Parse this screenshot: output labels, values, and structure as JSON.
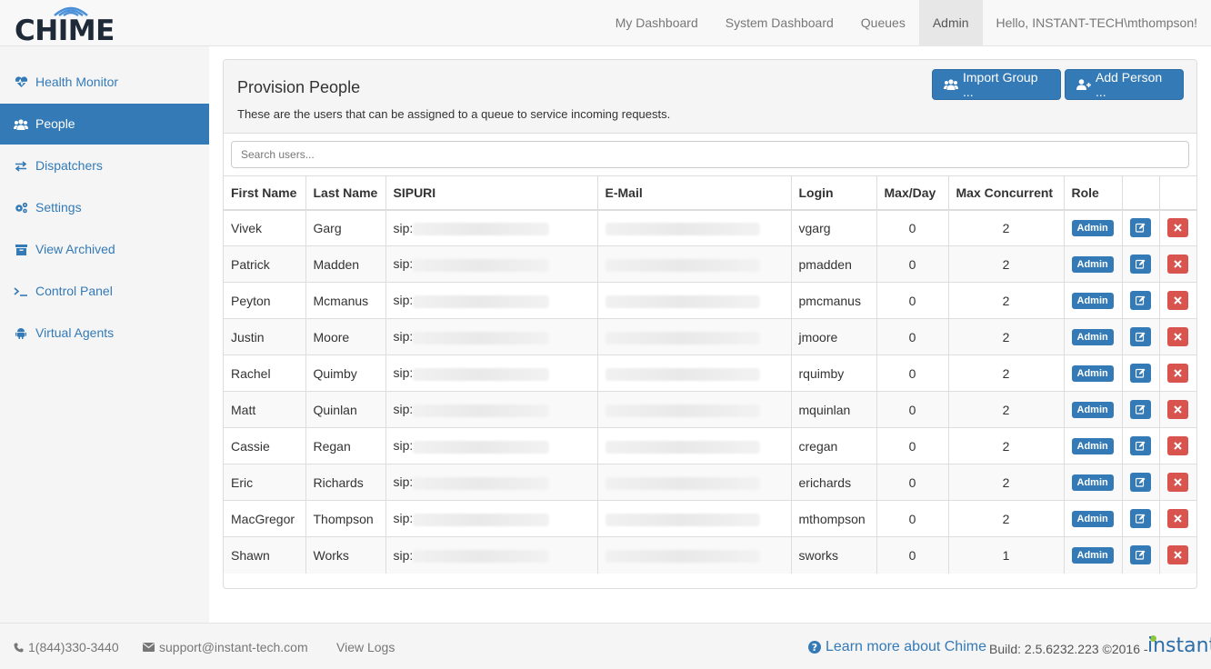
{
  "brand": {
    "logo_text": "CHIME"
  },
  "topnav": {
    "items": [
      "My Dashboard",
      "System Dashboard",
      "Queues",
      "Admin"
    ],
    "active": "Admin",
    "greeting": "Hello, INSTANT-TECH\\mthompson!"
  },
  "sidebar": {
    "items": [
      {
        "label": "Health Monitor",
        "icon": "heartbeat-icon"
      },
      {
        "label": "People",
        "icon": "users-icon"
      },
      {
        "label": "Dispatchers",
        "icon": "exchange-icon"
      },
      {
        "label": "Settings",
        "icon": "cogs-icon"
      },
      {
        "label": "View Archived",
        "icon": "archive-icon"
      },
      {
        "label": "Control Panel",
        "icon": "terminal-icon"
      },
      {
        "label": "Virtual Agents",
        "icon": "android-icon"
      }
    ],
    "active": "People"
  },
  "panel": {
    "title": "Provision People",
    "description": "These are the users that can be assigned to a queue to service incoming requests.",
    "import_label": "Import Group ...",
    "add_label": "Add Person ...",
    "search_placeholder": "Search users..."
  },
  "table": {
    "headers": [
      "First Name",
      "Last Name",
      "SIPURI",
      "E-Mail",
      "Login",
      "Max/Day",
      "Max Concurrent",
      "Role",
      "",
      ""
    ],
    "rows": [
      {
        "first": "Vivek",
        "last": "Garg",
        "sip": "sip:",
        "login": "vgarg",
        "maxday": "0",
        "maxcon": "2",
        "role": "Admin"
      },
      {
        "first": "Patrick",
        "last": "Madden",
        "sip": "sip:",
        "login": "pmadden",
        "maxday": "0",
        "maxcon": "2",
        "role": "Admin"
      },
      {
        "first": "Peyton",
        "last": "Mcmanus",
        "sip": "sip:",
        "login": "pmcmanus",
        "maxday": "0",
        "maxcon": "2",
        "role": "Admin"
      },
      {
        "first": "Justin",
        "last": "Moore",
        "sip": "sip:",
        "login": "jmoore",
        "maxday": "0",
        "maxcon": "2",
        "role": "Admin"
      },
      {
        "first": "Rachel",
        "last": "Quimby",
        "sip": "sip:",
        "login": "rquimby",
        "maxday": "0",
        "maxcon": "2",
        "role": "Admin"
      },
      {
        "first": "Matt",
        "last": "Quinlan",
        "sip": "sip:",
        "login": "mquinlan",
        "maxday": "0",
        "maxcon": "2",
        "role": "Admin"
      },
      {
        "first": "Cassie",
        "last": "Regan",
        "sip": "sip:",
        "login": "cregan",
        "maxday": "0",
        "maxcon": "2",
        "role": "Admin"
      },
      {
        "first": "Eric",
        "last": "Richards",
        "sip": "sip:",
        "login": "erichards",
        "maxday": "0",
        "maxcon": "2",
        "role": "Admin"
      },
      {
        "first": "MacGregor",
        "last": "Thompson",
        "sip": "sip:",
        "login": "mthompson",
        "maxday": "0",
        "maxcon": "2",
        "role": "Admin"
      },
      {
        "first": "Shawn",
        "last": "Works",
        "sip": "sip:",
        "login": "sworks",
        "maxday": "0",
        "maxcon": "1",
        "role": "Admin"
      }
    ]
  },
  "footer": {
    "phone": "1(844)330-3440",
    "email": "support@instant-tech.com",
    "view_logs": "View Logs",
    "learn_more": "Learn more about Chime",
    "build": "Build: 2.5.6232.223 ©2016 -",
    "instant_logo": "instant"
  },
  "colors": {
    "primary": "#337ab7",
    "danger": "#d9534f",
    "accent_green": "#8dc63f"
  }
}
